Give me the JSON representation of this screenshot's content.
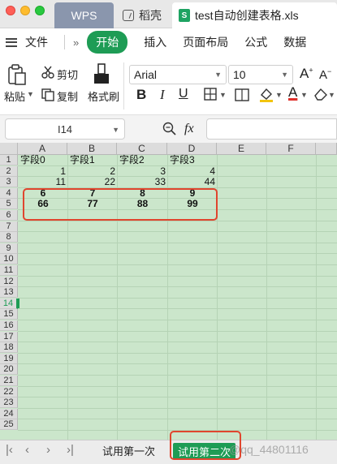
{
  "titlebar": {
    "tabs": [
      {
        "label": "WPS"
      },
      {
        "label": "稻壳"
      },
      {
        "label": "test自动创建表格.xls"
      }
    ]
  },
  "menu": {
    "file": "文件",
    "items": [
      "开始",
      "插入",
      "页面布局",
      "公式",
      "数据"
    ]
  },
  "toolbar": {
    "paste": "粘贴",
    "cut": "剪切",
    "copy": "复制",
    "format_painter": "格式刷",
    "font": "Arial",
    "size": "10"
  },
  "formula_bar": {
    "name_box": "I14",
    "fx": "fx"
  },
  "grid": {
    "columns": [
      "A",
      "B",
      "C",
      "D",
      "E",
      "F"
    ],
    "rows": [
      "1",
      "2",
      "3",
      "4",
      "5",
      "6",
      "7",
      "8",
      "9",
      "10",
      "11",
      "12",
      "13",
      "14",
      "15",
      "16",
      "17",
      "18",
      "19",
      "20",
      "21",
      "22",
      "23",
      "24",
      "25"
    ],
    "active_row": "14",
    "cells": {
      "r1": [
        "字段0",
        "字段1",
        "字段2",
        "字段3"
      ],
      "r2": [
        "1",
        "2",
        "3",
        "4"
      ],
      "r3": [
        "11",
        "22",
        "33",
        "44"
      ],
      "r4": [
        "6",
        "7",
        "8",
        "9"
      ],
      "r5": [
        "66",
        "77",
        "88",
        "99"
      ]
    }
  },
  "sheets": {
    "tabs": [
      "试用第一次",
      "试用第二次"
    ],
    "active_index": 1
  },
  "watermark": "@qq_44801116",
  "colors": {
    "accent": "#1e9c55",
    "grid_bg": "#cbe6cb",
    "highlight": "#e0452e"
  }
}
